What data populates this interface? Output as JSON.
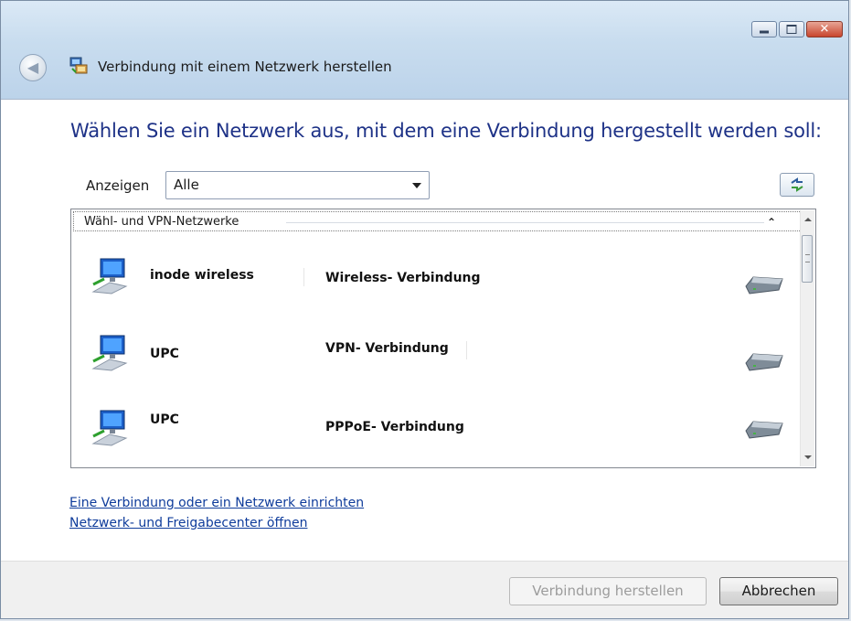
{
  "window": {
    "title": "Verbindung mit einem Netzwerk herstellen",
    "controls": {
      "minimize": "minimize",
      "maximize": "maximize",
      "close": "close"
    }
  },
  "heading": "Wählen Sie ein Netzwerk aus, mit dem eine Verbindung hergestellt werden soll:",
  "filter": {
    "label": "Anzeigen",
    "selected": "Alle"
  },
  "list": {
    "group_label": "Wähl- und VPN-Netzwerke",
    "networks": [
      {
        "name": "inode wireless",
        "type": "Wireless- Verbindung"
      },
      {
        "name": "UPC",
        "type": "VPN- Verbindung"
      },
      {
        "name": "UPC",
        "type": "PPPoE- Verbindung"
      }
    ]
  },
  "links": {
    "setup": "Eine Verbindung oder ein Netzwerk einrichten",
    "network_center": "Netzwerk- und Freigabecenter öffnen"
  },
  "buttons": {
    "connect": "Verbindung herstellen",
    "cancel": "Abbrechen"
  },
  "icons": {
    "back": "back-arrow-icon",
    "title": "network-connect-icon",
    "refresh": "refresh-icon",
    "network": "network-computer-icon",
    "modem": "modem-icon",
    "collapse": "chevron-up-icon"
  }
}
